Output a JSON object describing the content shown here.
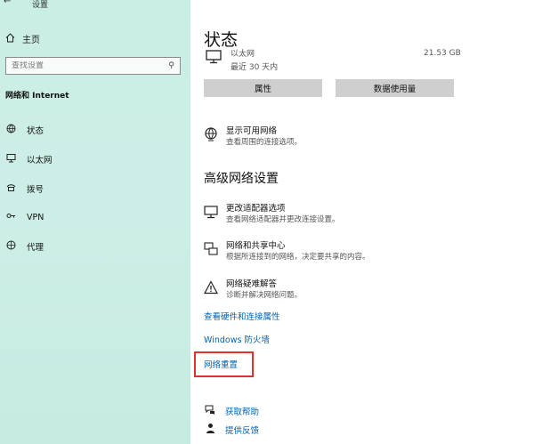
{
  "window": {
    "title": "设置",
    "back_glyph": "←"
  },
  "sidebar": {
    "home_label": "主页",
    "search_placeholder": "查找设置",
    "section_title": "网络和 Internet",
    "items": [
      {
        "label": "状态",
        "icon": "globe-status-icon"
      },
      {
        "label": "以太网",
        "icon": "ethernet-icon"
      },
      {
        "label": "拨号",
        "icon": "dialup-icon"
      },
      {
        "label": "VPN",
        "icon": "vpn-icon"
      },
      {
        "label": "代理",
        "icon": "proxy-globe-icon"
      }
    ]
  },
  "main": {
    "title": "状态",
    "ethernet": {
      "name": "以太网",
      "time": "最近 30 天内",
      "size": "21.53 GB"
    },
    "buttons": {
      "properties": "属性",
      "data_usage": "数据使用量"
    },
    "show_networks": {
      "title": "显示可用网络",
      "desc": "查看周围的连接选项。"
    },
    "advanced_heading": "高级网络设置",
    "advanced_items": [
      {
        "title": "更改适配器选项",
        "desc": "查看网络适配器并更改连接设置。",
        "icon": "adapter-icon"
      },
      {
        "title": "网络和共享中心",
        "desc": "根据所连接到的网络，决定要共享的内容。",
        "icon": "sharing-center-icon"
      },
      {
        "title": "网络疑难解答",
        "desc": "诊断并解决网络问题。",
        "icon": "warning-icon"
      }
    ],
    "links": {
      "hardware": "查看硬件和连接属性",
      "firewall": "Windows 防火墙",
      "reset": "网络重置"
    },
    "help": {
      "get_help": "获取帮助",
      "feedback": "提供反馈"
    }
  },
  "colors": {
    "accent_link": "#0063b1",
    "highlight_box": "#e0312a",
    "sidebar_bg": "#c9eee4"
  }
}
